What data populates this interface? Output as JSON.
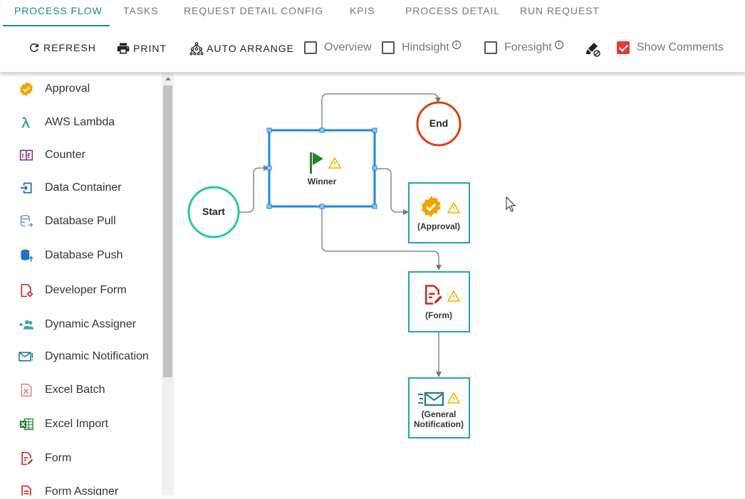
{
  "tabs": [
    {
      "label": "PROCESS FLOW",
      "active": true
    },
    {
      "label": "TASKS"
    },
    {
      "label": "REQUEST DETAIL CONFIG"
    },
    {
      "label": "KPIS"
    },
    {
      "label": "PROCESS DETAIL"
    },
    {
      "label": "RUN REQUEST"
    }
  ],
  "toolbar": {
    "refresh_label": "REFRESH",
    "print_label": "PRINT",
    "auto_arrange_label": "AUTO ARRANGE",
    "overview_label": "Overview",
    "overview_checked": false,
    "hindsight_label": "Hindsight",
    "hindsight_checked": false,
    "foresight_label": "Foresight",
    "foresight_checked": false,
    "show_comments_label": "Show Comments",
    "show_comments_checked": true,
    "info_glyph": "i"
  },
  "sidebar": {
    "items": [
      {
        "label": "Approval",
        "icon": "approval-badge-icon"
      },
      {
        "label": "AWS Lambda",
        "icon": "lambda-icon"
      },
      {
        "label": "Counter",
        "icon": "counter-icon"
      },
      {
        "label": "Data Container",
        "icon": "data-container-icon"
      },
      {
        "label": "Database Pull",
        "icon": "database-pull-icon"
      },
      {
        "label": "Database Push",
        "icon": "database-push-icon"
      },
      {
        "label": "Developer Form",
        "icon": "developer-form-icon"
      },
      {
        "label": "Dynamic Assigner",
        "icon": "dynamic-assigner-icon"
      },
      {
        "label": "Dynamic Notification",
        "icon": "dynamic-notification-icon"
      },
      {
        "label": "Excel Batch",
        "icon": "excel-batch-icon"
      },
      {
        "label": "Excel Import",
        "icon": "excel-import-icon"
      },
      {
        "label": "Form",
        "icon": "form-icon"
      },
      {
        "label": "Form Assigner",
        "icon": "form-assigner-icon"
      }
    ]
  },
  "flow": {
    "start_label": "Start",
    "end_label": "End",
    "winner_label": "Winner",
    "approval_label": "(Approval)",
    "form_label": "(Form)",
    "notification_label_line1": "(General",
    "notification_label_line2": "Notification)"
  },
  "colors": {
    "accent": "#1a8a8a",
    "selected_node": "#1e88e5",
    "node_border": "#26a0b8",
    "start_circle": "#26c6a6",
    "end_circle": "#d84315",
    "warning": "#f4b400",
    "checkbox_checked": "#e53935"
  }
}
